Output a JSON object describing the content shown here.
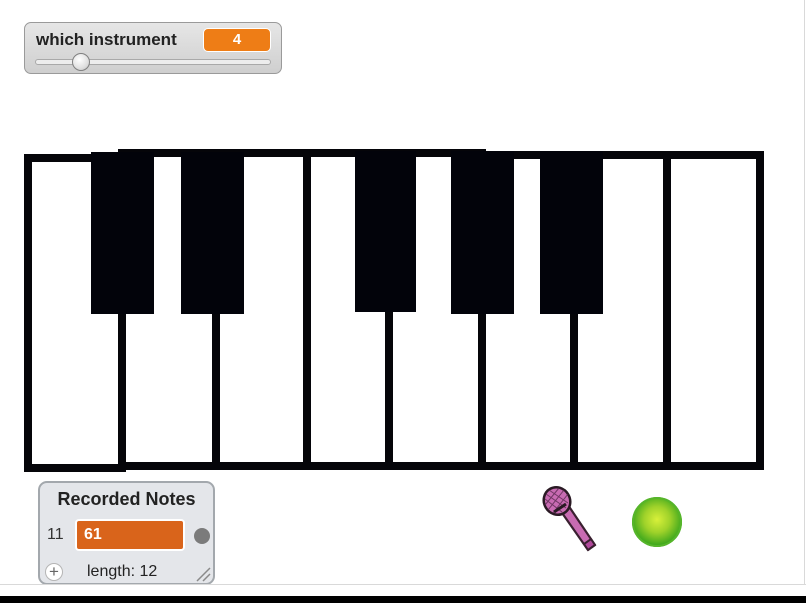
{
  "slider_monitor": {
    "label": "which instrument",
    "value": "4",
    "slider_fraction": 0.17
  },
  "piano": {
    "white_keys": 8,
    "black_keys": 5
  },
  "list_monitor": {
    "title": "Recorded Notes",
    "item_index": "11",
    "item_value": "61",
    "add_symbol": "+",
    "length_text": "length: 12"
  },
  "sprites": {
    "microphone": "microphone-icon",
    "go_button": "green-circle-button"
  },
  "colors": {
    "slider_value_bg": "#ee7d16",
    "list_item_bg": "#d9641b",
    "key_outline": "#050509",
    "mic_head": "#c86bb2"
  }
}
